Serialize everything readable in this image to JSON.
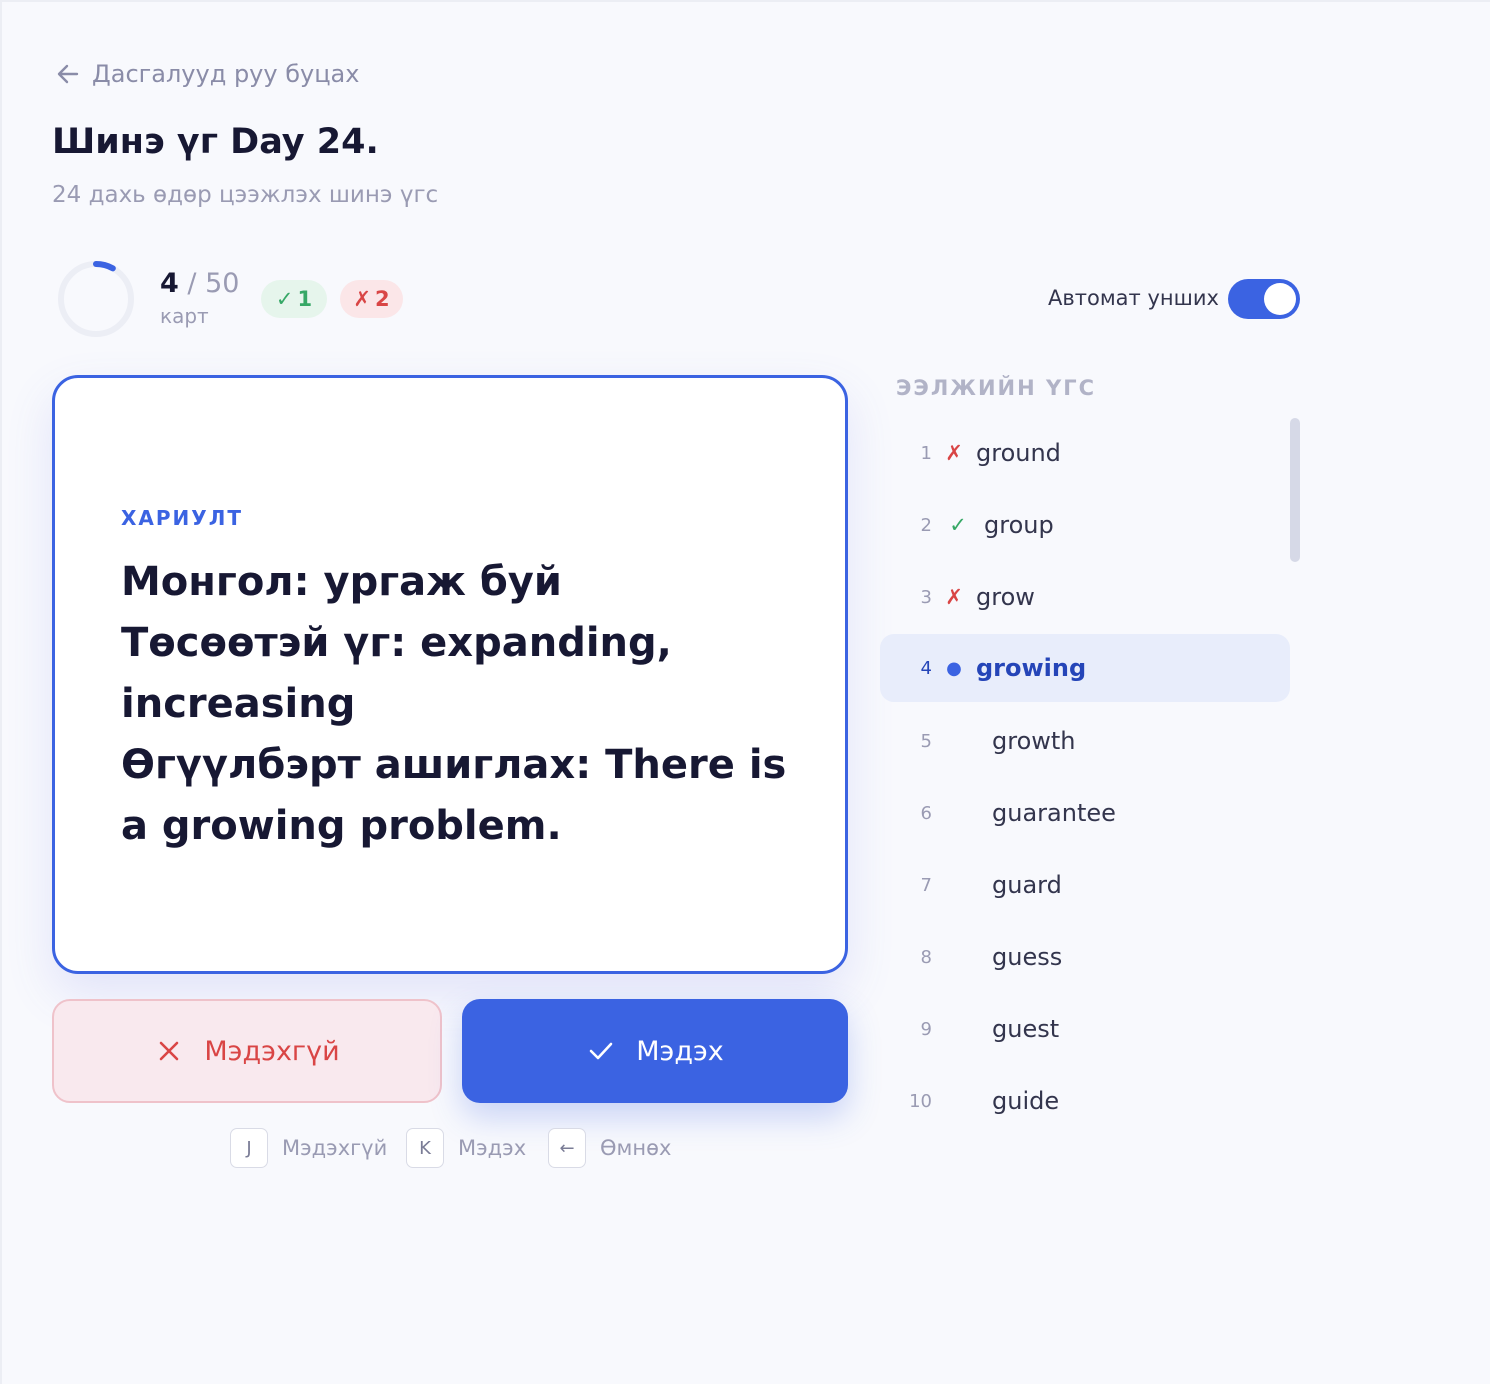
{
  "header": {
    "back_label": "Дасгалууд руу буцах",
    "title": "Шинэ үг Day 24.",
    "subtitle": "24 дахь өдөр цээжлэх шинэ үгс"
  },
  "progress": {
    "current": "4",
    "total": "/ 50",
    "unit": "карт",
    "fraction": 0.08,
    "correct_badge": "1",
    "wrong_badge": "2"
  },
  "auto_read": {
    "label": "Автомат унших",
    "enabled": true
  },
  "card": {
    "label": "ХАРИУЛТ",
    "answer": "Монгол: ургаж буй\nТөсөөтэй үг: expanding, increasing\nӨгүүлбэрт ашиглах: There is a growing problem."
  },
  "actions": {
    "dont_know": "Мэдэхгүй",
    "know": "Мэдэх"
  },
  "shortcuts": [
    {
      "key": "J",
      "label": "Мэдэхгүй"
    },
    {
      "key": "K",
      "label": "Мэдэх"
    },
    {
      "key": "←",
      "label": "Өмнөх"
    }
  ],
  "word_list": {
    "heading": "ЭЭЛЖИЙН ҮГС",
    "items": [
      {
        "num": "1",
        "mark": "✗",
        "word": "ground"
      },
      {
        "num": "2",
        "mark": "✓",
        "word": "group"
      },
      {
        "num": "3",
        "mark": "✗",
        "word": "grow"
      },
      {
        "num": "4",
        "mark": "●",
        "word": "growing"
      },
      {
        "num": "5",
        "mark": "",
        "word": "growth"
      },
      {
        "num": "6",
        "mark": "",
        "word": "guarantee"
      },
      {
        "num": "7",
        "mark": "",
        "word": "guard"
      },
      {
        "num": "8",
        "mark": "",
        "word": "guess"
      },
      {
        "num": "9",
        "mark": "",
        "word": "guest"
      },
      {
        "num": "10",
        "mark": "",
        "word": "guide"
      }
    ]
  },
  "colors": {
    "accent": "#3b63e2",
    "success": "#36a866",
    "danger": "#d94545"
  }
}
